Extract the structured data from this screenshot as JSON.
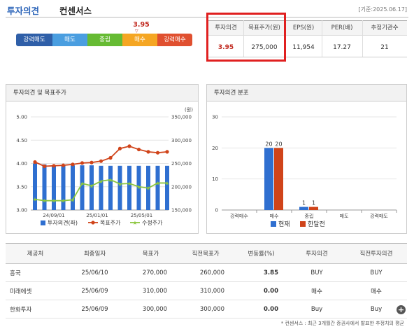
{
  "header": {
    "title_main": "투자의견",
    "title_sub": "컨센서스",
    "date": "[기준:2025.06.17]"
  },
  "opinion_bar": {
    "current_value": "3.95",
    "marker": "▽",
    "segments": [
      {
        "label": "강력매도",
        "color": "#2f5fa8"
      },
      {
        "label": "매도",
        "color": "#4a9ee0"
      },
      {
        "label": "중립",
        "color": "#66bb33"
      },
      {
        "label": "매수",
        "color": "#f5a623"
      },
      {
        "label": "강력매수",
        "color": "#e05030"
      }
    ]
  },
  "summary": {
    "headers": [
      "투자의견",
      "목표주가(원)",
      "EPS(원)",
      "PER(배)",
      "추정기관수"
    ],
    "values": [
      "3.95",
      "275,000",
      "11,954",
      "17.27",
      "21"
    ]
  },
  "panel_left_title": "투자의견 및 목표주가",
  "panel_right_title": "투자의견 분포",
  "chart_data": [
    {
      "type": "bar+line",
      "title": "투자의견 및 목표주가",
      "y_right_unit": "(원)",
      "x_tick_labels": [
        "24/09/01",
        "25/01/01",
        "25/05/01"
      ],
      "y_left_ticks": [
        "5.00",
        "4.50",
        "4.00",
        "3.50",
        "3.00"
      ],
      "y_left_range": [
        3.0,
        5.0
      ],
      "y_right_ticks": [
        "350,000",
        "300,000",
        "250,000",
        "200,000",
        "150,000"
      ],
      "y_right_range": [
        150000,
        350000
      ],
      "series": [
        {
          "name": "투자의견(좌)",
          "type": "bar",
          "axis": "left",
          "color": "#2f6fd0",
          "values": [
            4.0,
            3.98,
            3.96,
            3.96,
            3.96,
            3.96,
            3.96,
            3.95,
            3.95,
            3.95,
            3.95,
            3.95,
            3.95,
            3.95,
            3.95
          ]
        },
        {
          "name": "목표주가",
          "type": "line",
          "axis": "right",
          "color": "#d0441a",
          "values": [
            253000,
            244000,
            245000,
            246000,
            248000,
            251000,
            252000,
            255000,
            262000,
            282000,
            287000,
            280000,
            275000,
            273000,
            275000
          ]
        },
        {
          "name": "수정주가",
          "type": "line",
          "axis": "right",
          "color": "#8cc63f",
          "values": [
            173000,
            170000,
            170000,
            170000,
            172000,
            207000,
            202000,
            212000,
            215000,
            206000,
            207000,
            200000,
            197000,
            208000,
            208000
          ]
        }
      ]
    },
    {
      "type": "bar",
      "title": "투자의견 분포",
      "categories": [
        "강력매수",
        "매수",
        "중립",
        "매도",
        "강력매도"
      ],
      "ylim": [
        0,
        30
      ],
      "y_ticks": [
        "30",
        "20",
        "10",
        "0"
      ],
      "series": [
        {
          "name": "현재",
          "color": "#2f6fd0",
          "values": [
            0,
            20,
            1,
            0,
            0
          ]
        },
        {
          "name": "한달전",
          "color": "#d0441a",
          "values": [
            0,
            20,
            1,
            0,
            0
          ]
        }
      ],
      "data_labels": [
        "20",
        "20",
        "1",
        "1"
      ]
    }
  ],
  "table": {
    "headers": [
      "제공처",
      "최종일자",
      "목표가",
      "직전목표가",
      "변동률(%)",
      "투자의견",
      "직전투자의견"
    ],
    "rows": [
      [
        "흥국",
        "25/06/10",
        "270,000",
        "260,000",
        "3.85",
        "BUY",
        "BUY"
      ],
      [
        "미래에셋",
        "25/06/09",
        "310,000",
        "310,000",
        "0.00",
        "매수",
        "매수"
      ],
      [
        "한화투자",
        "25/06/09",
        "300,000",
        "300,000",
        "0.00",
        "Buy",
        "Buy"
      ]
    ]
  },
  "footer_note": "* 컨센서스 : 최근 3개월간 증권사에서 발표한 추정치의 평균",
  "more_icon": "+"
}
